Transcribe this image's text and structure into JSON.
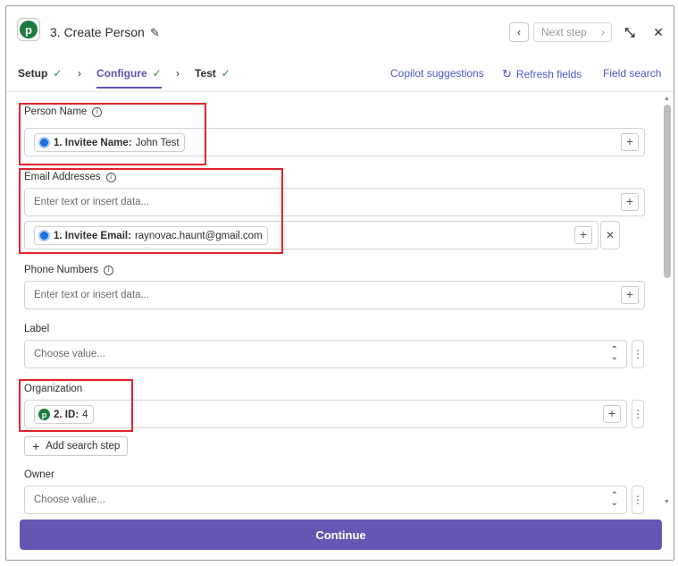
{
  "header": {
    "title": "3. Create Person",
    "next_step_label": "Next step",
    "logo_letter": "p"
  },
  "tabs": [
    {
      "label": "Setup",
      "done": true
    },
    {
      "label": "Configure",
      "done": true
    },
    {
      "label": "Test",
      "done": true
    }
  ],
  "links": {
    "copilot": "Copilot suggestions",
    "refresh": "Refresh fields",
    "field_search": "Field search"
  },
  "fields": {
    "person_name": {
      "label": "Person Name",
      "pill_ref": "1. Invitee Name:",
      "pill_value": "John Test"
    },
    "email": {
      "label": "Email Addresses",
      "placeholder": "Enter text or insert data...",
      "pill_ref": "1. Invitee Email:",
      "pill_value": "raynovac.haunt@gmail.com"
    },
    "phone": {
      "label": "Phone Numbers",
      "placeholder": "Enter text or insert data..."
    },
    "label_field": {
      "label": "Label",
      "placeholder": "Choose value..."
    },
    "organization": {
      "label": "Organization",
      "pill_ref": "2. ID:",
      "pill_value": "4",
      "pill_icon_letter": "p"
    },
    "add_search_step": "Add search step",
    "owner": {
      "label": "Owner",
      "placeholder": "Choose value..."
    }
  },
  "continue_label": "Continue",
  "colors": {
    "accent": "#5f52b0",
    "continue_bg": "#6258b4",
    "link": "#4b57c6",
    "success": "#2b8a3e",
    "highlight": "#e0242b",
    "pipedrive_green": "#1c7b3d"
  }
}
